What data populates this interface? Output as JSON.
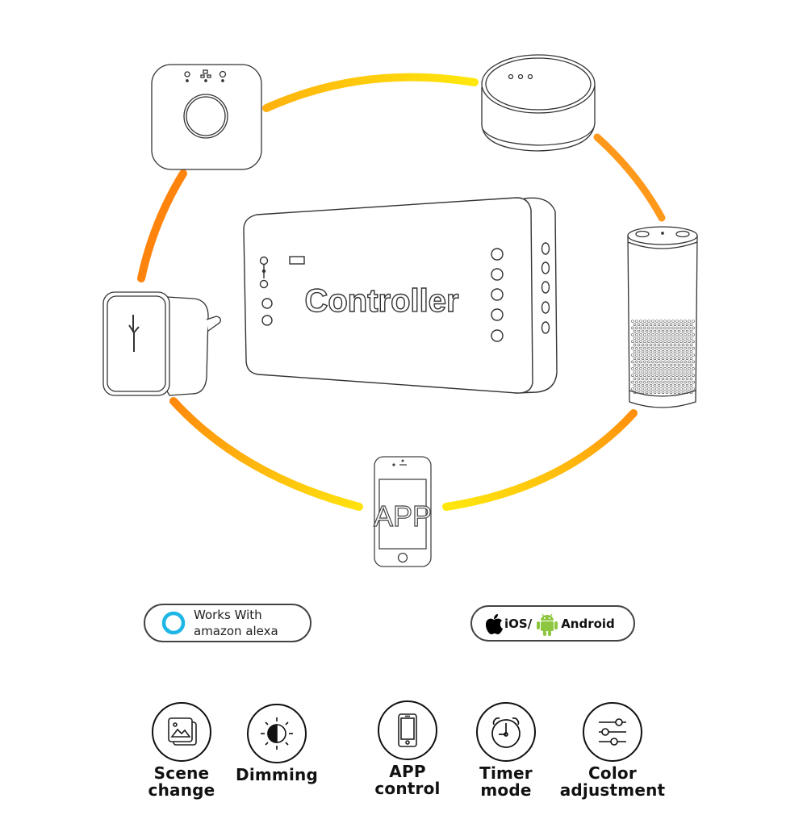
{
  "diagram": {
    "center_device": {
      "label": "Controller"
    },
    "phone_device": {
      "label": "APP"
    },
    "devices": [
      {
        "name": "Hub bridge"
      },
      {
        "name": "Smart speaker puck"
      },
      {
        "name": "Cylinder smart speaker"
      },
      {
        "name": "Smartphone APP"
      },
      {
        "name": "Plug-in gateway"
      }
    ],
    "arc_colors": {
      "orange": "#ff8000",
      "yellow": "#ffe000",
      "amber": "#ffb000"
    }
  },
  "badges": {
    "alexa": {
      "line1": "Works With",
      "line2": "amazon alexa",
      "icon_color": "#1eb6e6"
    },
    "platforms": {
      "ios_label": "iOS/",
      "android_label": "Android",
      "android_color": "#8dc63f"
    }
  },
  "features": [
    {
      "icon": "scene-change-icon",
      "line1": "Scene",
      "line2": "change"
    },
    {
      "icon": "dimming-icon",
      "line1": "Dimming",
      "line2": ""
    },
    {
      "icon": "app-control-icon",
      "line1": "APP",
      "line2": "control"
    },
    {
      "icon": "timer-icon",
      "line1": "Timer",
      "line2": "mode"
    },
    {
      "icon": "color-adjust-icon",
      "line1": "Color",
      "line2": "adjustment"
    }
  ]
}
